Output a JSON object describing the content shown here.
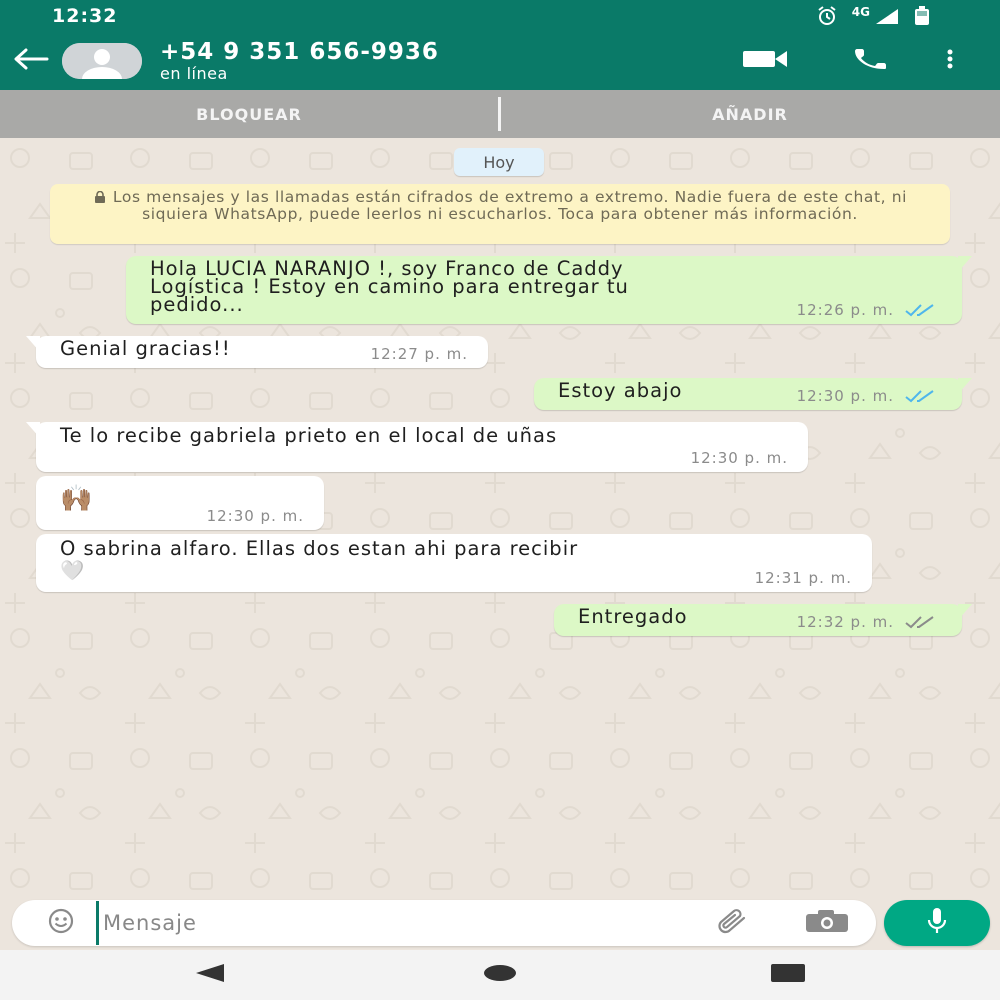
{
  "status_bar": {
    "time": "12:32",
    "network": "4G",
    "icons": [
      "alarm-icon",
      "signal-icon",
      "battery-icon"
    ]
  },
  "header": {
    "contact_name": "+54 9 351 656-9936",
    "contact_status": "en línea",
    "icons": [
      "back-arrow-icon",
      "video-call-icon",
      "phone-icon",
      "more-vert-icon"
    ]
  },
  "actions": {
    "block": "BLOQUEAR",
    "add": "AÑADIR"
  },
  "chat": {
    "date_chip": "Hoy",
    "encryption_notice": "Los mensajes y las llamadas están cifrados de extremo a extremo. Nadie fuera de este chat, ni siquiera WhatsApp, puede leerlos ni escucharlos. Toca para obtener más información.",
    "messages": [
      {
        "direction": "out",
        "text": "Hola LUCIA NARANJO !, soy Franco de Caddy\nLogística ! Estoy en camino para entregar tu\npedido...",
        "time": "12:26 p. m.",
        "status": "read"
      },
      {
        "direction": "in",
        "text": "Genial gracias!!",
        "time": "12:27 p. m."
      },
      {
        "direction": "out",
        "text": "Estoy abajo",
        "time": "12:30 p. m.",
        "status": "read"
      },
      {
        "direction": "in",
        "text": "Te lo recibe gabriela prieto en el local de uñas",
        "time": "12:30 p. m."
      },
      {
        "direction": "in",
        "text": "🙌🏽",
        "time": "12:30 p. m."
      },
      {
        "direction": "in",
        "text": "O sabrina alfaro. Ellas dos estan ahi para recibir\n🤍",
        "time": "12:31 p. m."
      },
      {
        "direction": "out",
        "text": "Entregado",
        "time": "12:32 p. m.",
        "status": "delivered"
      }
    ]
  },
  "input": {
    "placeholder": "Mensaje",
    "icons": [
      "emoji-icon",
      "attach-icon",
      "camera-icon",
      "mic-icon"
    ]
  },
  "colors": {
    "primary": "#0a7a68",
    "outgoing_bubble": "#dcf8c6",
    "incoming_bubble": "#ffffff",
    "read_ticks": "#4fb6ec",
    "delivered_ticks": "#8b8b8b",
    "fab": "#00a884"
  }
}
